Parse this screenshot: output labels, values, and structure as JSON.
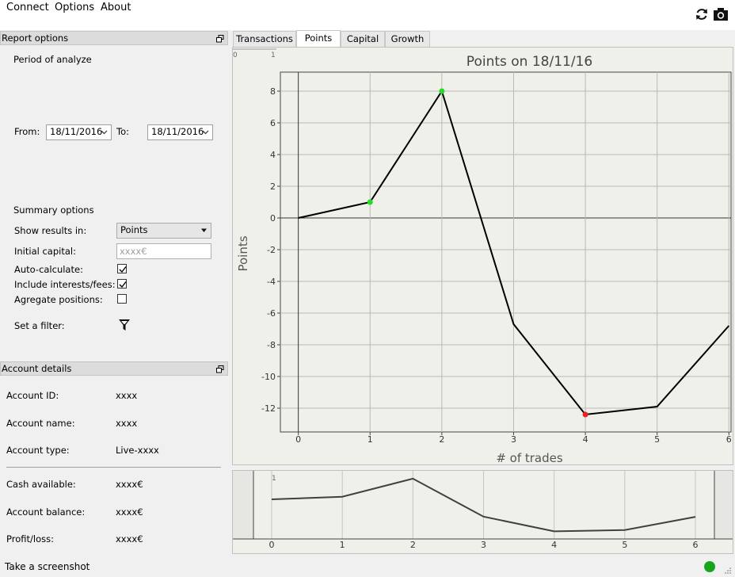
{
  "menu": {
    "items": [
      "Connect",
      "Options",
      "About"
    ]
  },
  "toolbar": {
    "icons": [
      "refresh-icon",
      "camera-icon"
    ]
  },
  "report_options": {
    "title": "Report options",
    "period_label": "Period of analyze",
    "from_label": "From:",
    "from_value": "18/11/2016",
    "to_label": "To:",
    "to_value": "18/11/2016",
    "summary_label": "Summary options",
    "show_results_label": "Show results in:",
    "show_results_value": "Points",
    "initial_capital_label": "Initial capital:",
    "initial_capital_placeholder": "xxxx€",
    "auto_calc_label": "Auto-calculate:",
    "auto_calc_checked": true,
    "include_fees_label": "Include interests/fees:",
    "include_fees_checked": true,
    "aggregate_label": "Agregate positions:",
    "aggregate_checked": false,
    "filter_label": "Set a filter:"
  },
  "account_details": {
    "title": "Account details",
    "id_label": "Account ID:",
    "id_value": "xxxx",
    "name_label": "Account name:",
    "name_value": "xxxx",
    "type_label": "Account type:",
    "type_value": "Live-xxxx",
    "cash_label": "Cash available:",
    "cash_value": "xxxx€",
    "balance_label": "Account balance:",
    "balance_value": "xxxx€",
    "pl_label": "Profit/loss:",
    "pl_value": "xxxx€"
  },
  "tabs": [
    {
      "label": "Transactions",
      "active": false
    },
    {
      "label": "Points",
      "active": true
    },
    {
      "label": "Capital",
      "active": false
    },
    {
      "label": "Growth",
      "active": false
    }
  ],
  "status": {
    "text": "Take a screenshot",
    "indicator_color": "#1aa41a"
  },
  "chart_data": {
    "type": "line",
    "title": "Points on 18/11/16",
    "xlabel": "# of trades",
    "ylabel": "Points",
    "x": [
      0,
      1,
      2,
      3,
      4,
      5,
      6
    ],
    "y": [
      0,
      1,
      8,
      -6.7,
      -12.4,
      -11.9,
      -6.8
    ],
    "xlim": [
      -0.25,
      6.03
    ],
    "ylim": [
      -13.5,
      9.2
    ],
    "x_ticks": [
      0,
      1,
      2,
      3,
      4,
      5,
      6
    ],
    "y_ticks": [
      -12,
      -10,
      -8,
      -6,
      -4,
      -2,
      0,
      2,
      4,
      6,
      8
    ],
    "grid": true,
    "line_color": "#000000",
    "highlighted_points": [
      {
        "x": 1,
        "y": 1,
        "color": "#22dd22"
      },
      {
        "x": 2,
        "y": 8,
        "color": "#22dd22"
      },
      {
        "x": 4,
        "y": -12.4,
        "color": "#ee2222"
      }
    ],
    "range_labels": [
      "0",
      "1"
    ],
    "navigator": {
      "x_ticks": [
        0,
        1,
        2,
        3,
        4,
        5,
        6
      ],
      "range_label": "1",
      "line_color": "#404040"
    }
  }
}
